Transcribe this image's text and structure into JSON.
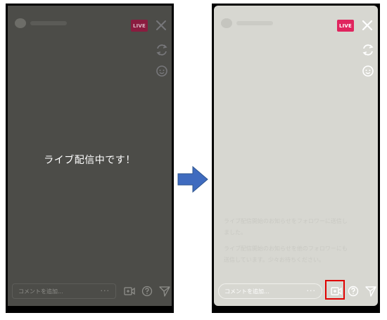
{
  "left_phone": {
    "live_badge": "LIVE",
    "center_message": "ライブ配信中です！",
    "comment_placeholder": "コメントを追加...",
    "dots": "···"
  },
  "right_phone": {
    "live_badge": "LIVE",
    "comment_placeholder": "コメントを追加...",
    "dots": "···",
    "notice_line1": "ライブ配信開始のお知らせをフォロワーに送信し",
    "notice_line2": "ました。",
    "notice_line3": "ライブ配信開始のお知らせを他のフォロワーにも",
    "notice_line4": "送信しています。少々お待ちください。"
  },
  "colors": {
    "highlight": "#e00000",
    "arrow": "#3f6bbf",
    "live_badge": "#e0245e"
  }
}
